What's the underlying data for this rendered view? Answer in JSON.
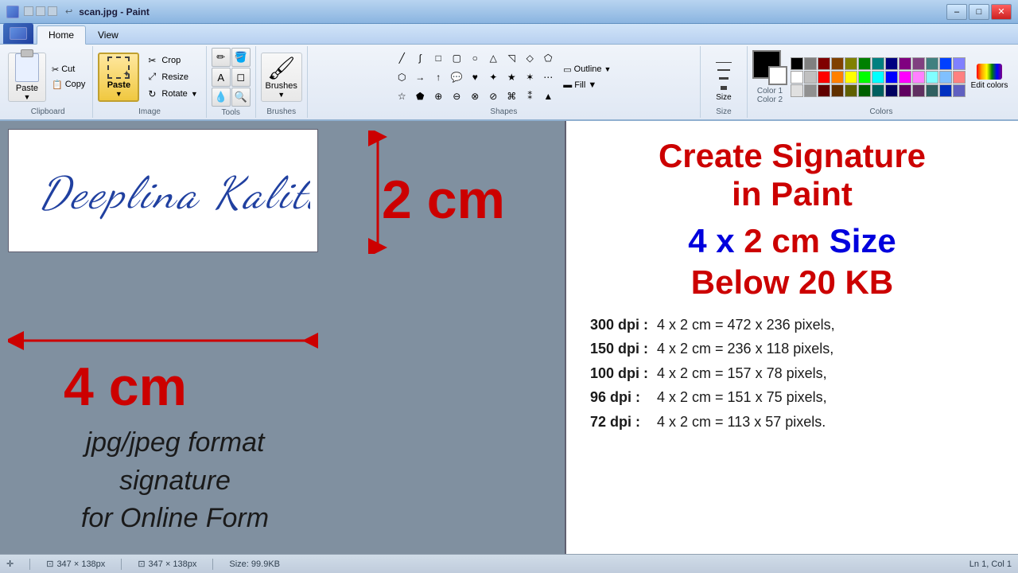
{
  "titleBar": {
    "title": "scan.jpg - Paint",
    "minimize": "–",
    "maximize": "□",
    "close": "✕"
  },
  "ribbon": {
    "tabs": [
      "Home",
      "View"
    ],
    "activeTab": "Home",
    "groups": {
      "clipboard": {
        "label": "Clipboard",
        "pasteLabel": "Paste",
        "cutLabel": "Cut",
        "copyLabel": "Copy"
      },
      "image": {
        "label": "Image",
        "cropLabel": "Crop",
        "resizeLabel": "Resize",
        "rotateLabel": "Rotate"
      },
      "tools": {
        "label": "Tools"
      },
      "brushes": {
        "label": "Brushes"
      },
      "shapes": {
        "label": "Shapes"
      },
      "size": {
        "label": "Size"
      },
      "colors": {
        "label": "Colors",
        "color1Label": "Color 1",
        "color2Label": "Color 2",
        "editColorsLabel": "Edit colors"
      }
    }
  },
  "canvas": {
    "signatureText": "Deeplina   Kalita",
    "dimensionV": "2 cm",
    "dimensionH": "4 cm",
    "bottomText": "jpg/jpeg format\nsignature\nfor Online Form"
  },
  "rightPanel": {
    "title": "Create Signature\nin Paint",
    "sizeLabel": "4 x 2 cm Size",
    "belowLabel": "Below 20 KB",
    "dpiRows": [
      {
        "dpi": "300 dpi :",
        "calc": "4 x 2 cm = 472 x 236 pixels,"
      },
      {
        "dpi": "150 dpi :",
        "calc": "4 x 2 cm = 236 x 118 pixels,"
      },
      {
        "dpi": "100 dpi :",
        "calc": "4 x 2 cm = 157 x 78 pixels,"
      },
      {
        "dpi": "96 dpi  :",
        "calc": "4 x 2 cm = 151 x 75 pixels,"
      },
      {
        "dpi": "72 dpi  :",
        "calc": "4 x 2 cm =  113 x 57 pixels."
      }
    ]
  },
  "statusBar": {
    "tool": "✛",
    "dim1": "347 × 138px",
    "dim2": "347 × 138px",
    "size": "Size: 99.9KB",
    "cursor": "Ln 1, Col 1"
  },
  "colors": {
    "topRow": [
      "#000000",
      "#808080",
      "#800000",
      "#804000",
      "#808000",
      "#008000",
      "#008080",
      "#000080",
      "#800080",
      "#804080",
      "#408080",
      "#0040ff",
      "#8080ff"
    ],
    "bottomRow": [
      "#ffffff",
      "#c0c0c0",
      "#ff0000",
      "#ff8000",
      "#ffff00",
      "#00ff00",
      "#00ffff",
      "#0000ff",
      "#ff00ff",
      "#ff80ff",
      "#80ffff",
      "#80c0ff",
      "#ff8080"
    ]
  }
}
